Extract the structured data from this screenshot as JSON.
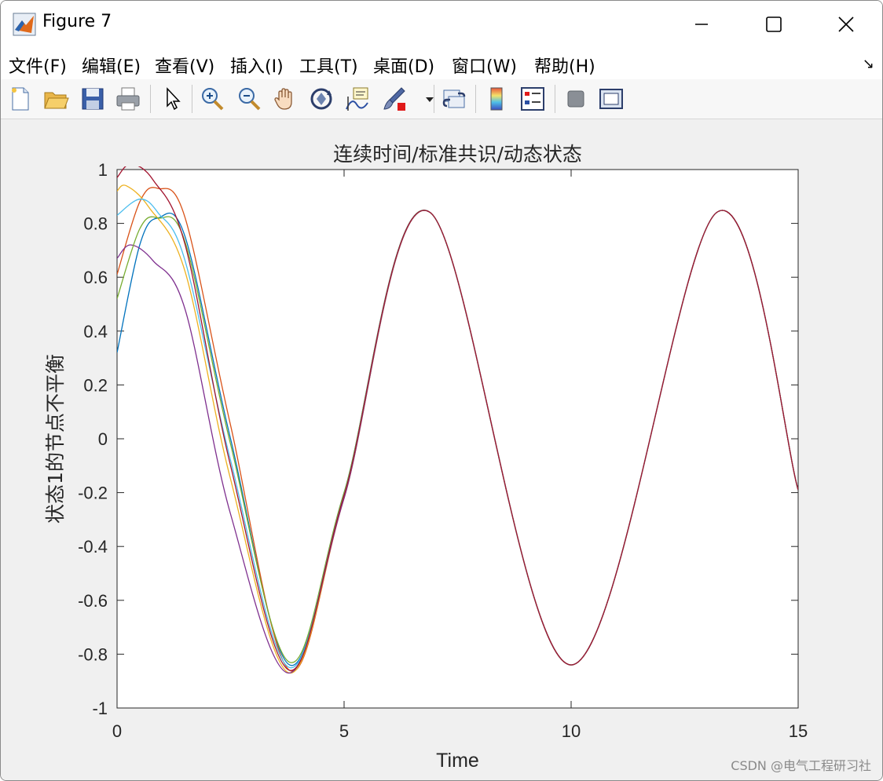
{
  "window": {
    "title": "Figure 7",
    "controls": {
      "minimize": "minimize",
      "maximize": "maximize",
      "close": "close"
    }
  },
  "menu": [
    "文件(F)",
    "编辑(E)",
    "查看(V)",
    "插入(I)",
    "工具(T)",
    "桌面(D)",
    "窗口(W)",
    "帮助(H)"
  ],
  "menu_overflow_icon": "dock-arrow-icon",
  "toolbar": [
    {
      "name": "new-figure-icon"
    },
    {
      "name": "open-file-icon"
    },
    {
      "name": "save-icon"
    },
    {
      "name": "print-icon"
    },
    {
      "name": "pointer-icon"
    },
    {
      "name": "zoom-in-icon"
    },
    {
      "name": "zoom-out-icon"
    },
    {
      "name": "pan-hand-icon"
    },
    {
      "name": "rotate-3d-icon"
    },
    {
      "name": "data-cursor-icon"
    },
    {
      "name": "brush-icon"
    },
    {
      "name": "link-plot-icon"
    },
    {
      "name": "colorbar-icon"
    },
    {
      "name": "legend-icon"
    },
    {
      "name": "hide-plot-tools-icon"
    },
    {
      "name": "show-plot-tools-icon"
    }
  ],
  "watermark": "CSDN @电气工程研习社",
  "chart_data": {
    "type": "line",
    "title": "连续时间/标准共识/动态状态",
    "xlabel": "Time",
    "ylabel": "状态1的节点不平衡",
    "xlim": [
      0,
      15
    ],
    "ylim": [
      -1,
      1
    ],
    "xticks": [
      "0",
      "5",
      "10",
      "15"
    ],
    "yticks": [
      "-1",
      "-0.8",
      "-0.6",
      "-0.4",
      "-0.2",
      "0",
      "0.2",
      "0.4",
      "0.6",
      "0.8",
      "1"
    ],
    "grid": false,
    "common_trajectory": {
      "description_values": "after convergence all series follow a common sinusoid",
      "amplitude": 0.84,
      "period": 6.28,
      "peak_times": [
        6.9,
        13.2
      ],
      "trough_times": [
        3.8,
        10.0
      ]
    },
    "series": [
      {
        "color": "#0072BD",
        "x": [
          0,
          0.5,
          0.9,
          1.5,
          2.5,
          3.8,
          5,
          6.9,
          10.0,
          13.2,
          15
        ],
        "y": [
          0.32,
          0.72,
          0.82,
          0.75,
          0.0,
          -0.84,
          -0.2,
          0.84,
          -0.84,
          0.84,
          -0.19
        ]
      },
      {
        "color": "#D95319",
        "x": [
          0,
          0.5,
          0.9,
          1.5,
          2.5,
          3.8,
          5,
          6.9,
          10.0,
          13.2,
          15
        ],
        "y": [
          0.61,
          0.88,
          0.93,
          0.82,
          0.05,
          -0.86,
          -0.22,
          0.84,
          -0.84,
          0.84,
          -0.19
        ]
      },
      {
        "color": "#EDB120",
        "x": [
          0,
          0.2,
          0.7,
          1.5,
          2.5,
          3.8,
          5,
          6.9,
          10.0,
          13.2,
          15
        ],
        "y": [
          0.92,
          0.94,
          0.86,
          0.62,
          -0.15,
          -0.87,
          -0.22,
          0.84,
          -0.84,
          0.84,
          -0.19
        ]
      },
      {
        "color": "#7E2F8E",
        "x": [
          0,
          0.3,
          0.8,
          1.5,
          2.5,
          3.8,
          5,
          6.9,
          10.0,
          13.2,
          15
        ],
        "y": [
          0.67,
          0.72,
          0.66,
          0.48,
          -0.28,
          -0.87,
          -0.22,
          0.84,
          -0.84,
          0.84,
          -0.19
        ]
      },
      {
        "color": "#77AC30",
        "x": [
          0,
          0.5,
          0.9,
          1.5,
          2.5,
          3.8,
          5,
          6.9,
          10.0,
          13.2,
          15
        ],
        "y": [
          0.52,
          0.78,
          0.82,
          0.73,
          -0.02,
          -0.83,
          -0.2,
          0.84,
          -0.84,
          0.84,
          -0.19
        ]
      },
      {
        "color": "#4DBEEE",
        "x": [
          0,
          0.5,
          0.9,
          1.5,
          2.5,
          3.8,
          5,
          6.9,
          10.0,
          13.2,
          15
        ],
        "y": [
          0.83,
          0.89,
          0.84,
          0.66,
          -0.08,
          -0.85,
          -0.21,
          0.84,
          -0.84,
          0.84,
          -0.19
        ]
      },
      {
        "color": "#A2142F",
        "x": [
          0,
          0.3,
          0.8,
          1.5,
          2.5,
          3.8,
          5,
          6.9,
          10.0,
          13.2,
          15
        ],
        "y": [
          0.97,
          1.02,
          0.96,
          0.72,
          -0.1,
          -0.86,
          -0.21,
          0.84,
          -0.84,
          0.84,
          -0.19
        ]
      }
    ]
  }
}
